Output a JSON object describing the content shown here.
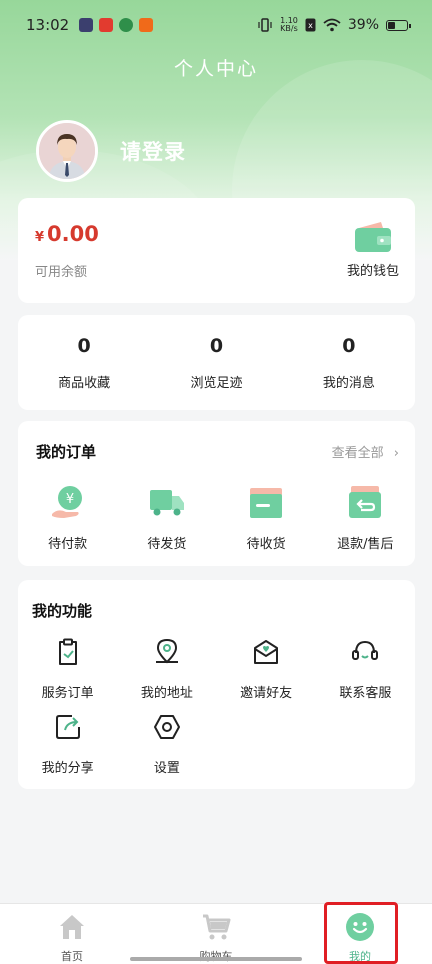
{
  "status_bar": {
    "time": "13:02",
    "net_speed_value": "1.10",
    "net_speed_unit": "KB/s",
    "battery": "39%"
  },
  "header": {
    "title": "个人中心",
    "login_text": "请登录"
  },
  "wallet": {
    "currency": "¥",
    "balance": "0.00",
    "balance_label": "可用余额",
    "wallet_label": "我的钱包"
  },
  "stats": [
    {
      "value": "0",
      "label": "商品收藏"
    },
    {
      "value": "0",
      "label": "浏览足迹"
    },
    {
      "value": "0",
      "label": "我的消息"
    }
  ],
  "orders": {
    "title": "我的订单",
    "view_all": "查看全部",
    "items": [
      {
        "label": "待付款",
        "icon": "payment-icon"
      },
      {
        "label": "待发货",
        "icon": "truck-icon"
      },
      {
        "label": "待收货",
        "icon": "box-icon"
      },
      {
        "label": "退款/售后",
        "icon": "refund-icon"
      }
    ]
  },
  "functions": {
    "title": "我的功能",
    "items": [
      {
        "label": "服务订单",
        "icon": "clipboard-icon"
      },
      {
        "label": "我的地址",
        "icon": "location-icon"
      },
      {
        "label": "邀请好友",
        "icon": "invite-mail-icon"
      },
      {
        "label": "联系客服",
        "icon": "headset-icon"
      },
      {
        "label": "我的分享",
        "icon": "share-icon"
      },
      {
        "label": "设置",
        "icon": "settings-icon"
      }
    ]
  },
  "tabs": [
    {
      "label": "首页",
      "icon": "home-icon"
    },
    {
      "label": "购物车",
      "icon": "cart-icon"
    },
    {
      "label": "我的",
      "icon": "smile-face-icon",
      "active": true
    }
  ],
  "colors": {
    "accent": "#4db38a",
    "price": "#d63a2e",
    "header_green": "#97d79a",
    "highlight": "#e01e24"
  }
}
